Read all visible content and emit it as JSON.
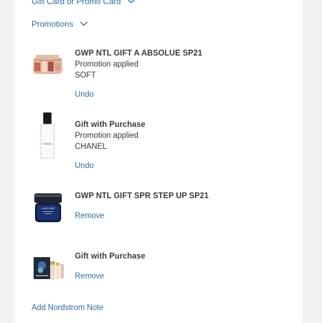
{
  "gift_card_label": "Gift Card or Promo Card",
  "promotions_label": "Promotions",
  "items": [
    {
      "title": "GWP NTL GIFT A ABSOLUE SP21",
      "status": "Promotion applied",
      "brand": "SOFT",
      "action": "Undo"
    },
    {
      "title": "Gift with Purchase",
      "status": "Promotion applied",
      "brand": "CHANEL",
      "action": "Undo"
    },
    {
      "title": "GWP NTL GIFT SPR STEP UP SP21",
      "action": "Remove"
    },
    {
      "title": "Gift with Purchase",
      "action": "Remove"
    }
  ],
  "chanel_bottle_label": "CHANEL",
  "lancome_jar_label": "LANCOME",
  "add_note_label": "Add Nordstrom Note",
  "colors": {
    "link": "#2e6ba3",
    "text": "#393939",
    "background": "#f2f2f2",
    "panel": "#ffffff"
  }
}
